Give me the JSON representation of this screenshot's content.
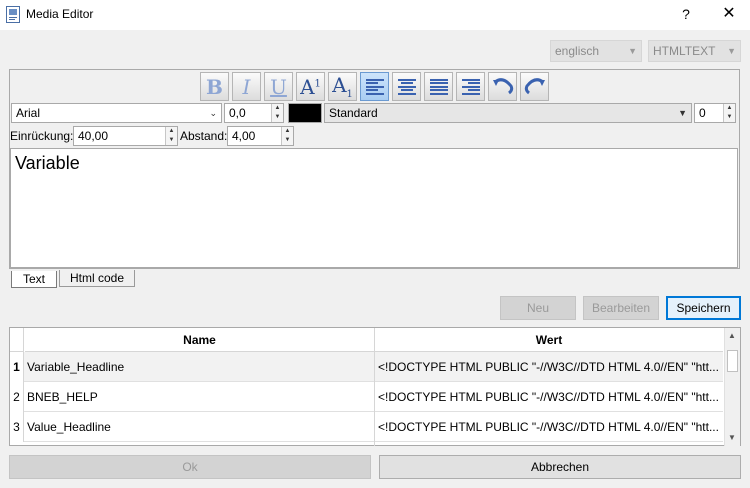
{
  "window": {
    "title": "Media Editor",
    "help_glyph": "?",
    "close_glyph": "✕"
  },
  "top_selects": {
    "language": "englisch",
    "format": "HTMLTEXT"
  },
  "toolbar": {
    "bold": "B",
    "italic": "I",
    "underline": "U",
    "superscript_base": "A",
    "superscript_mark": "1",
    "subscript_base": "A",
    "subscript_mark": "1"
  },
  "format_row": {
    "font": "Arial",
    "font_size": "0,0",
    "text_color": "#000000",
    "style": "Standard",
    "style_value": "0"
  },
  "indent_row": {
    "indent_label": "Einrückung:",
    "indent_value": "40,00",
    "spacing_label": "Abstand:",
    "spacing_value": "4,00"
  },
  "editor": {
    "content": "Variable"
  },
  "tabs": [
    {
      "label": "Text",
      "active": true
    },
    {
      "label": "Html code",
      "active": false
    }
  ],
  "actions": {
    "new": "Neu",
    "edit": "Bearbeiten",
    "save": "Speichern"
  },
  "table": {
    "columns": [
      "Name",
      "Wert"
    ],
    "rows": [
      {
        "num": "1",
        "name": "Variable_Headline",
        "value": "<!DOCTYPE HTML PUBLIC \"-//W3C//DTD HTML 4.0//EN\" \"htt..."
      },
      {
        "num": "2",
        "name": "BNEB_HELP",
        "value": "<!DOCTYPE HTML PUBLIC \"-//W3C//DTD HTML 4.0//EN\" \"htt..."
      },
      {
        "num": "3",
        "name": "Value_Headline",
        "value": "<!DOCTYPE HTML PUBLIC \"-//W3C//DTD HTML 4.0//EN\" \"htt..."
      }
    ]
  },
  "footer": {
    "ok": "Ok",
    "cancel": "Abbrechen"
  }
}
